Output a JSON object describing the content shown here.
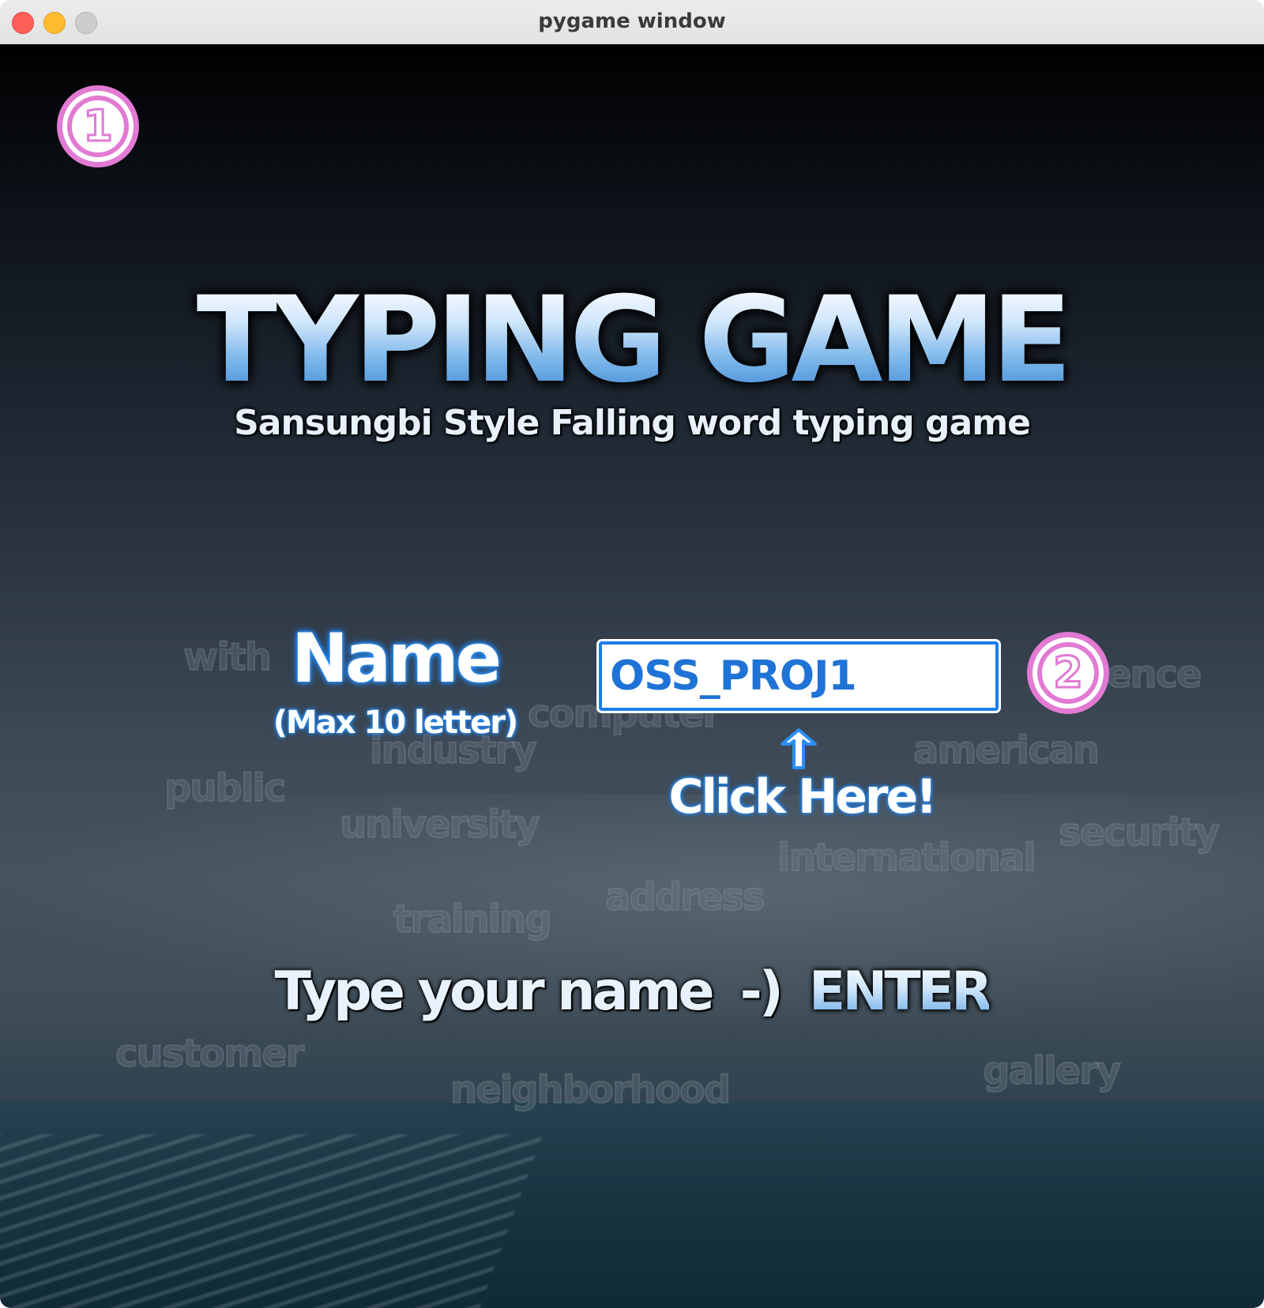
{
  "window": {
    "title": "pygame window"
  },
  "markers": {
    "first": "1",
    "second": "2"
  },
  "game": {
    "title": "TYPING GAME",
    "subtitle": "Sansungbi Style Falling word typing game",
    "name_label": "Name",
    "name_hint": "(Max 10 letter)",
    "name_value": "OSS_PROJ1",
    "click_here": "Click Here!",
    "instruction_prefix": "Type your name",
    "instruction_arrow": "-)",
    "instruction_key": "ENTER"
  },
  "background_words": [
    "with",
    "computer",
    "industry",
    "public",
    "university",
    "address",
    "international",
    "security",
    "training",
    "customer",
    "neighborhood",
    "gallery",
    "american",
    "ence"
  ],
  "colors": {
    "accent_blue": "#2b8ef5",
    "marker_pink": "#e27ad3",
    "input_text": "#1f73d6"
  },
  "icons": {
    "up_arrow": "arrow-up-icon"
  }
}
